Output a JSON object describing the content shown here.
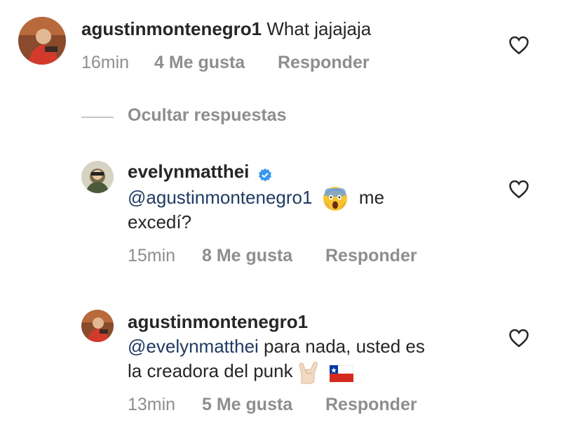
{
  "comments": [
    {
      "username": "agustinmontenegro1",
      "text": "What jajajaja",
      "time": "16min",
      "likes": "4 Me gusta",
      "reply": "Responder"
    },
    {
      "username": "evelynmatthei",
      "verified": true,
      "mention": "@agustinmontenegro1",
      "emoji": "scream-emoji",
      "text_line1_end": "me",
      "text_line2": "excedí?",
      "time": "15min",
      "likes": "8 Me gusta",
      "reply": "Responder"
    },
    {
      "username": "agustinmontenegro1",
      "mention": "@evelynmatthei",
      "text_line1_end": " para nada, usted es",
      "text_line2": "la creadora del punk",
      "emojis": [
        "rock-hand-emoji",
        "chile-flag-emoji"
      ],
      "time": "13min",
      "likes": "5 Me gusta",
      "reply": "Responder"
    }
  ],
  "hide_replies": "Ocultar respuestas",
  "colors": {
    "mention": "#1f3b63",
    "meta": "#8e8e8e",
    "verified": "#3897f0"
  }
}
